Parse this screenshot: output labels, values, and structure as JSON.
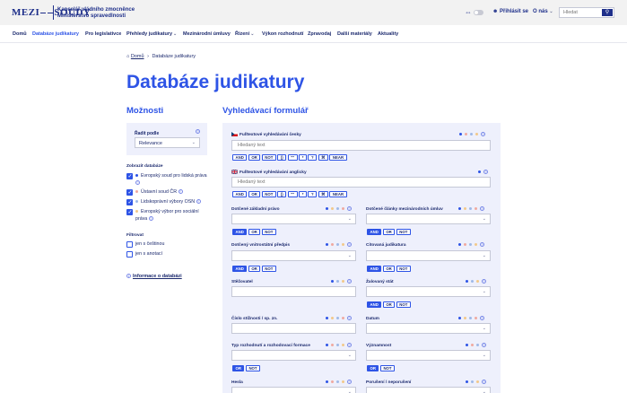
{
  "header": {
    "logo_left": "MEZI",
    "logo_right": "SOUDY",
    "office_line1": "Kancelář vládního zmocněnce",
    "office_line2": "Ministerstvo spravedlnosti",
    "login_label": "Přihlásit se",
    "about_label": "O nás",
    "search_placeholder": "Hledat"
  },
  "nav": {
    "items": [
      {
        "label": "Domů"
      },
      {
        "label": "Databáze judikatury"
      },
      {
        "label": "Pro legislativce"
      },
      {
        "label": "Přehledy judikatury"
      },
      {
        "label": "Mezinárodní úmluvy"
      },
      {
        "label": "Řízení"
      },
      {
        "label": "Výkon rozhodnutí"
      },
      {
        "label": "Zpravodaj"
      },
      {
        "label": "Další materiály"
      },
      {
        "label": "Aktuality"
      }
    ]
  },
  "breadcrumb": {
    "home": "Domů",
    "current": "Databáze judikatury"
  },
  "page_title": "Databáze judikatury",
  "sidebar": {
    "title": "Možnosti",
    "sort_label": "Řadit podle",
    "sort_value": "Relevance",
    "db_heading": "Zobrazit databáze",
    "databases": [
      {
        "label": "Evropský soud pro lidská práva",
        "color": "#2e54e6",
        "checked": true
      },
      {
        "label": "Ústavní soud ČR",
        "color": "#f0a9a0",
        "checked": true
      },
      {
        "label": "Lidskoprávní výbory OSN",
        "color": "#9fb9e8",
        "checked": true
      },
      {
        "label": "Evropský výbor pro sociální práva",
        "color": "#f2c98a",
        "checked": true
      }
    ],
    "filter_heading": "Filtrovat",
    "filters": [
      {
        "label": "jen s češtinou",
        "checked": false
      },
      {
        "label": "jen s anotací",
        "checked": false
      }
    ],
    "info_link": "Informace o databázi"
  },
  "form": {
    "title": "Vyhledávací formulář",
    "fulltext_cz_label": "Fulltextové vyhledávání česky",
    "fulltext_cz_placeholder": "Hledaný text",
    "fulltext_en_label": "Fulltextové vyhledávání anglicky",
    "fulltext_en_placeholder": "Hledaný text",
    "text_ops": [
      "AND",
      "OR",
      "NOT",
      "()",
      "\"\"",
      "*",
      "?",
      "⌘",
      "NEAR"
    ],
    "fields": {
      "zakladni_pravo": "Dotčené základní právo",
      "clanky_umluv": "Dotčené články mezinárodních úmluv",
      "vnitrostatni_predpis": "Dotčený vnitrostátní předpis",
      "citovana_judikatura": "Citovaná judikatura",
      "stezovatel": "Stěžovatel",
      "zalovany_stat": "Žalovaný stát",
      "cislo_stiznosti": "Číslo stížnosti / sp. zn.",
      "datum": "Datum",
      "typ_rozhodnuti": "Typ rozhodnutí a rozhodovací formace",
      "vyznamnost": "Významnost",
      "hesla": "Hesla",
      "poruseni": "Porušení / neporušení"
    },
    "ops_three": [
      "AND",
      "OR",
      "NOT"
    ],
    "ops_two": [
      "OR",
      "NOT"
    ]
  },
  "colors": {
    "brand": "#1e2f8a",
    "accent": "#2e54e6",
    "panel": "#eef0fc",
    "dot_blue": "#2e54e6",
    "dot_pink": "#f0a9a0",
    "dot_lightblue": "#9fb9e8",
    "dot_orange": "#f2c98a"
  },
  "icons": {
    "contrast": "contrast-arrows-icon",
    "user": "user-icon",
    "search": "search-icon",
    "home": "home-icon",
    "help": "question-circle-icon",
    "info": "info-circle-icon",
    "flag_cz": "czech-flag-icon",
    "flag_uk": "uk-flag-icon"
  }
}
